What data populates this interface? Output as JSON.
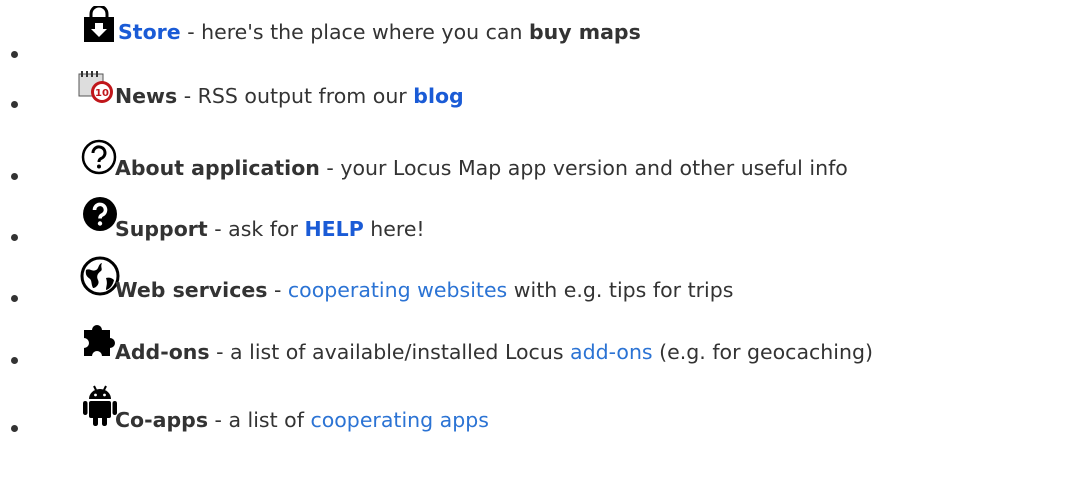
{
  "items": [
    {
      "icon": "shopping-bag-download-icon",
      "title": "Store",
      "sep": " - here's the place where you can ",
      "bold_tail": "buy maps"
    },
    {
      "icon": "news-calendar-badge-icon",
      "badge": "10",
      "title": "News",
      "sep": " - RSS output from our ",
      "link": "blog"
    },
    {
      "icon": "question-circle-outline-icon",
      "title": "About application",
      "text": " - your Locus Map app version and other useful info"
    },
    {
      "icon": "question-circle-filled-icon",
      "title": "Support",
      "sep": " - ask for ",
      "link": "HELP",
      "after": " here!"
    },
    {
      "icon": "globe-icon",
      "title": "Web services",
      "sep": " - ",
      "link": "cooperating websites",
      "after": " with e.g. tips for trips"
    },
    {
      "icon": "puzzle-piece-icon",
      "title": "Add-ons",
      "sep": " - a list of available/installed Locus ",
      "link": "add-ons",
      "after": " (e.g. for geocaching)"
    },
    {
      "icon": "android-robot-icon",
      "title": "Co-apps",
      "sep": " - a list of ",
      "link": "cooperating apps"
    }
  ],
  "colors": {
    "link": "#2b73d4",
    "link_strong": "#1a5bd6",
    "text": "#333333"
  }
}
